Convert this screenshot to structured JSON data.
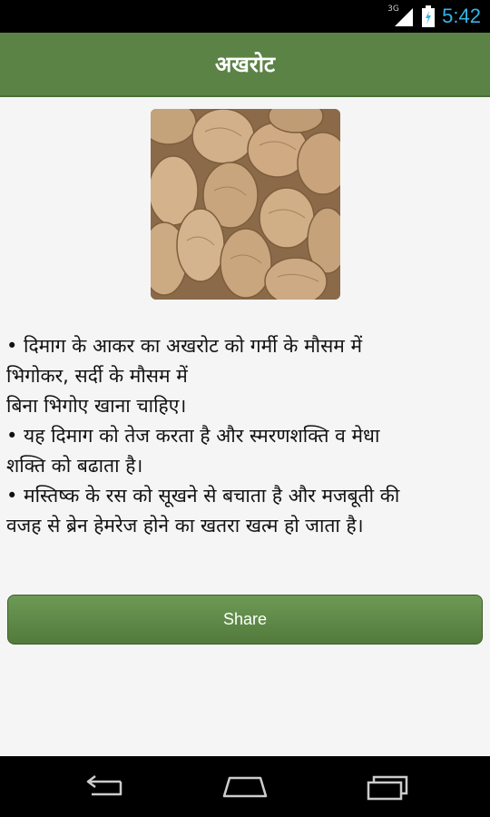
{
  "status_bar": {
    "time": "5:42",
    "network": "3G",
    "icons": [
      "signal-icon",
      "battery-icon"
    ]
  },
  "header": {
    "title": "अखरोट"
  },
  "image": {
    "alt": "walnut-photo"
  },
  "content": {
    "lines": [
      "• दिमाग के आकर का अखरोट को गर्मी के मौसम में",
      "भिगोकर, सर्दी के मौसम में",
      "बिना भिगोए खाना चाहिए।",
      "• यह दिमाग को तेज करता है और स्मरणशक्ति व मेधा",
      "शक्ति को बढाता है।",
      "• मस्तिष्क के रस को सूखने से बचाता है और मजबूती की",
      "वजह से ब्रेन हेमरेज होने का खतरा खत्म हो जाता है।"
    ]
  },
  "share_button": {
    "label": "Share"
  },
  "nav_bar": {
    "icons": [
      "back-icon",
      "home-icon",
      "recent-apps-icon"
    ]
  },
  "colors": {
    "header_green": "#5b8346",
    "button_green": "#6d9a55",
    "clock_blue": "#33b5e5",
    "background": "#f5f5f5"
  }
}
